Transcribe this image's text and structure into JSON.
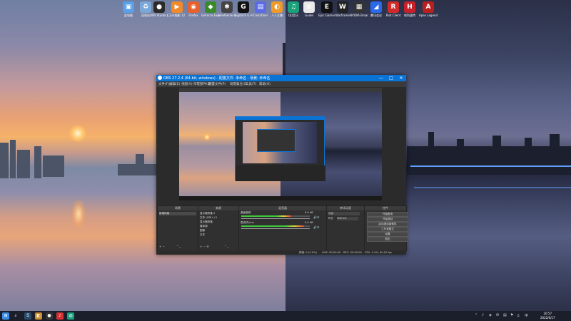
{
  "desktop": {
    "icons": [
      {
        "label": "此电脑",
        "icon": "computer-icon",
        "color": "#5aa0e8",
        "glyph": "▣"
      },
      {
        "label": "回收站",
        "icon": "recycle-bin-icon",
        "color": "#7aa8d8",
        "glyph": "♻"
      },
      {
        "label": "OBS Studio 媒体编辑",
        "icon": "obs-icon",
        "color": "#2b2b2b",
        "glyph": "●"
      },
      {
        "label": "万兴喵影 12",
        "icon": "filmora-icon",
        "color": "#f08a2a",
        "glyph": "▶"
      },
      {
        "label": "Firefox",
        "icon": "firefox-icon",
        "color": "#e8602a",
        "glyph": "◉"
      },
      {
        "label": "GeForce Experience",
        "icon": "nvidia-icon",
        "color": "#3a8a2a",
        "glyph": "◆"
      },
      {
        "label": "SteelSeries Engine",
        "icon": "steelseries-icon",
        "color": "#444",
        "glyph": "✱"
      },
      {
        "label": "Logitech G HUB",
        "icon": "logitech-icon",
        "color": "#111",
        "glyph": "G"
      },
      {
        "label": "CrossOver",
        "icon": "crossover-icon",
        "color": "#5b6be8",
        "glyph": "▤"
      },
      {
        "label": "人人主播",
        "icon": "streamer-icon",
        "color": "#f09a2a",
        "glyph": "◐"
      },
      {
        "label": "QQ音乐",
        "icon": "qq-music-icon",
        "color": "#1aa07a",
        "glyph": "♫"
      },
      {
        "label": "Guide",
        "icon": "document-icon",
        "color": "#e8e8e8",
        "glyph": "≡"
      },
      {
        "label": "Epic Games",
        "icon": "epic-icon",
        "color": "#111",
        "glyph": "E"
      },
      {
        "label": "Warframe",
        "icon": "warframe-icon",
        "color": "#222",
        "glyph": "W"
      },
      {
        "label": "NVIDIA Broadcast setting",
        "icon": "broadcast-icon",
        "color": "#333",
        "glyph": "▦"
      },
      {
        "label": "腾讯会议",
        "icon": "tencent-meeting-icon",
        "color": "#2a6ae8",
        "glyph": "◢"
      },
      {
        "label": "Riot Client",
        "icon": "riot-icon",
        "color": "#d12a2a",
        "glyph": "R"
      },
      {
        "label": "哈利波特",
        "icon": "game-icon",
        "color": "#c8202a",
        "glyph": "H"
      },
      {
        "label": "Apex Legends",
        "icon": "apex-icon",
        "color": "#b82020",
        "glyph": "A"
      }
    ]
  },
  "obs": {
    "title": "OBS 27.2.4 (64-bit, windows) - 配置文件: 未命名 - 场景: 未命名",
    "window_controls": {
      "minimize": "—",
      "maximize": "□",
      "close": "✕"
    },
    "menu": [
      "文件(F)",
      "编辑(E)",
      "视图(V)",
      "停靠部件(D)",
      "配置文件(P)",
      "场景集合(S)",
      "工具(T)",
      "帮助(H)"
    ],
    "docks": {
      "scenes": {
        "header": "场景",
        "items": [
          "新增场景"
        ]
      },
      "sources": {
        "header": "来源",
        "items": [
          "显示器采集 2",
          "文本 (GDI+) 2",
          "显示器采集",
          "媒体源",
          "图像",
          "文本"
        ]
      },
      "mixer": {
        "header": "混音器",
        "channels": [
          {
            "name": "桌面音频",
            "level": "0.0 dB"
          },
          {
            "name": "麦克风/Aux",
            "level": "0.0 dB"
          }
        ]
      },
      "transitions": {
        "header": "转场动画",
        "type": "淡出",
        "duration_label": "时长",
        "duration": "300 ms"
      },
      "controls": {
        "header": "控件",
        "buttons": [
          "开始推流",
          "开始录制",
          "启动虚拟摄像机",
          "工作室模式",
          "设置",
          "退出"
        ]
      }
    },
    "status": {
      "live": "LIVE: 00:00:00",
      "rec": "REC: 00:00:00",
      "cpu": "CPU: 0.4%, 60.00 fps",
      "dropped": "掉帧: 0 (0.0%)"
    }
  },
  "taskbar": {
    "apps": [
      {
        "icon": "windows-start-icon",
        "color": "#3a8ee8",
        "glyph": "⊞"
      },
      {
        "icon": "search-icon",
        "color": "#1b1f2b",
        "glyph": "⌕"
      },
      {
        "icon": "steam-icon",
        "color": "#2a4a6a",
        "glyph": "S"
      },
      {
        "icon": "app-icon",
        "color": "#c88a2a",
        "glyph": "◧"
      },
      {
        "icon": "obs-taskbar-icon",
        "color": "#333",
        "glyph": "●"
      },
      {
        "icon": "netease-icon",
        "color": "#d83030",
        "glyph": "♪"
      },
      {
        "icon": "qq-icon",
        "color": "#1aa07a",
        "glyph": "◍"
      }
    ],
    "tray": [
      "⌃",
      "♪",
      "◈",
      "✉",
      "▤",
      "⚑",
      "ﾛ",
      "中"
    ],
    "time": "20:57",
    "date": "2022/6/17"
  }
}
